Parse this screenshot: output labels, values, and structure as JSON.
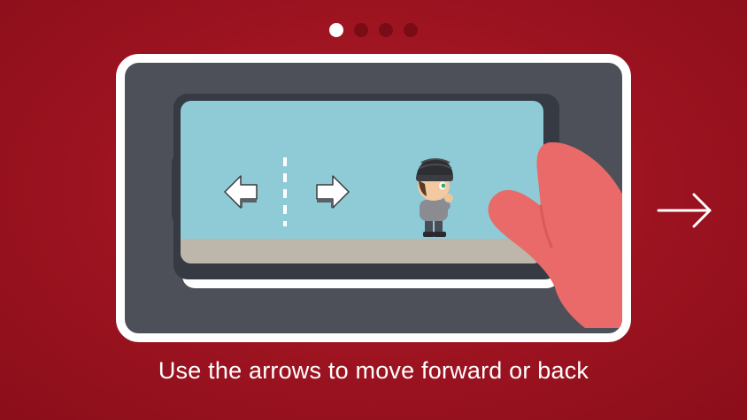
{
  "pagination": {
    "total": 4,
    "current": 1
  },
  "tutorial": {
    "caption": "Use the arrows to move forward or back"
  },
  "controls": {
    "left_icon": "arrow-left-icon",
    "right_icon": "arrow-right-icon",
    "next_icon": "long-arrow-right-icon"
  },
  "colors": {
    "background": "#9c1320",
    "card_bg": "#4d5058",
    "screen_sky": "#8ecbd6",
    "ground": "#bdb6ab",
    "hand": "#e96a68",
    "dot_active": "#ffffff",
    "dot_inactive": "#7a0c17"
  }
}
